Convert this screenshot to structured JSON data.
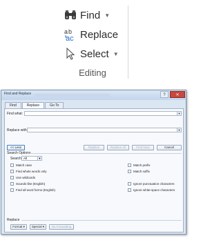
{
  "ribbon": {
    "find_label": "Find",
    "replace_label": "Replace",
    "select_label": "Select",
    "group_label": "Editing"
  },
  "dialog": {
    "title": "Find and Replace",
    "tabs": [
      "Find",
      "Replace",
      "Go To"
    ],
    "find_what_label": "Find what:",
    "replace_with_label": "Replace with:",
    "less_button": "<< Less",
    "replace_button": "Replace",
    "replace_all_button": "Replace All",
    "find_next_button": "Find Next",
    "cancel_button": "Cancel",
    "search_options_label": "Search Options",
    "search_label": "Search:",
    "search_value": "All",
    "options_left": [
      "Match case",
      "Find whole words only",
      "Use wildcards",
      "Sounds like (English)",
      "Find all word forms (English)"
    ],
    "options_right": [
      "Match prefix",
      "Match suffix",
      "Ignore punctuation characters",
      "Ignore white-space characters"
    ],
    "replace_section_label": "Replace",
    "format_button": "Format",
    "special_button": "Special",
    "no_formatting_button": "No Formatting"
  }
}
